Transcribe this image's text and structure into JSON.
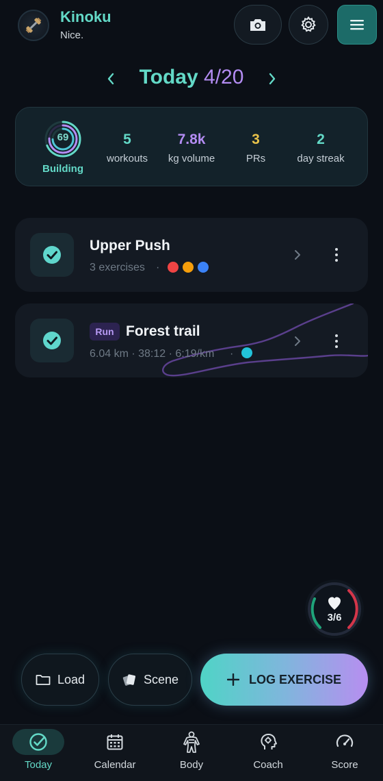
{
  "header": {
    "app_name": "Kinoku",
    "subtitle": "Nice.",
    "avatar_icon": "dumbbell-icon",
    "camera_icon": "camera-icon",
    "settings_icon": "gear-icon",
    "menu_icon": "hamburger-menu-icon"
  },
  "date_nav": {
    "today_label": "Today",
    "date": "4/20"
  },
  "stats": {
    "ring_value": "69",
    "ring_label": "Building",
    "items": [
      {
        "value": "5",
        "label": "workouts",
        "color": "#63d9c7"
      },
      {
        "value": "7.8k",
        "label": "kg volume",
        "color": "#b38cf2"
      },
      {
        "value": "3",
        "label": "PRs",
        "color": "#e8c24a"
      },
      {
        "value": "2",
        "label": "day streak",
        "color": "#63d9c7"
      }
    ]
  },
  "workouts": [
    {
      "title": "Upper Push",
      "subtitle": "3 exercises",
      "separator": "·",
      "dots": [
        "#ef4444",
        "#f59e0b",
        "#3b82f6"
      ]
    },
    {
      "badge": "Run",
      "title": "Forest trail",
      "subtitle": "6.04 km · 38:12 · 6:19/km",
      "separator": "·",
      "dot_color": "#22c3d9"
    }
  ],
  "heart_gauge": {
    "count": "3/6",
    "icon": "heart-icon"
  },
  "actions": {
    "load_label": "Load",
    "load_icon": "folder-icon",
    "scene_label": "Scene",
    "scene_icon": "cards-icon",
    "log_label": "LOG EXERCISE",
    "log_icon": "plus-icon"
  },
  "nav": {
    "items": [
      {
        "label": "Today",
        "icon": "check-circle-icon",
        "active": true
      },
      {
        "label": "Calendar",
        "icon": "calendar-icon",
        "active": false
      },
      {
        "label": "Body",
        "icon": "body-icon",
        "active": false
      },
      {
        "label": "Coach",
        "icon": "coach-head-icon",
        "active": false
      },
      {
        "label": "Score",
        "icon": "gauge-icon",
        "active": false
      }
    ]
  },
  "colors": {
    "accent_teal": "#63d9c7",
    "accent_purple": "#b38cf2",
    "background": "#0b0f16"
  }
}
